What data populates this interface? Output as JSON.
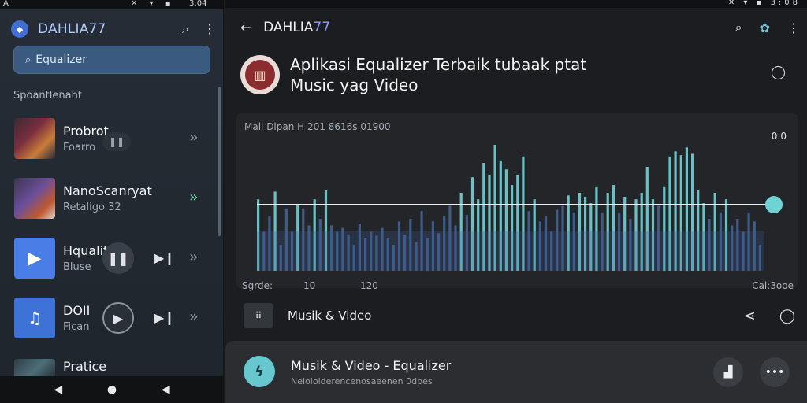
{
  "status_left": {
    "left": "A",
    "icons": "✕ ▾ ▪",
    "time": "3:04"
  },
  "status_right": {
    "icons": "✕ ▾ ▪ 3:08"
  },
  "left_panel": {
    "app_title": "DAHLIA77",
    "search_placeholder": "Equalizer",
    "section_label": "Spoantlenaht",
    "items": [
      {
        "title": "Probrot",
        "subtitle": "Foarro"
      },
      {
        "title": "NanoScanryat",
        "subtitle": "Retaligo 32"
      },
      {
        "title": "Hqualit",
        "subtitle": "Bluse"
      },
      {
        "title": "DOII",
        "subtitle": "Fican"
      },
      {
        "title": "Pratice",
        "subtitle": ""
      }
    ]
  },
  "right_panel": {
    "title_prefix": "DAHLIA",
    "title_accent": "77",
    "headline": "Aplikasi Equalizer Terbaik tubaak ptat Music yag Video",
    "eq_info": "Mall Dlpan H 201 8616s 01900",
    "eq_time": "0:0",
    "axis": {
      "start": "Sgrde:",
      "t1": "10",
      "t2": "120",
      "end": "Cal:3ooe"
    },
    "tag_label": "Musik & Video",
    "tag_icon_text": "⠿",
    "bottom_title": "Musik & Video - Equalizer",
    "bottom_subtitle": "Neloloiderencenosaeenen 0dpes"
  },
  "colors": {
    "accent_teal": "#6ec5d8",
    "bar_teal": "#6fd3d6",
    "bar_blue": "#4a6ea8",
    "title_blue": "#aec9ff"
  },
  "equalizer": {
    "progress": 1.0,
    "bars": [
      0.55,
      0.3,
      0.42,
      0.61,
      0.2,
      0.48,
      0.3,
      0.51,
      0.48,
      0.35,
      0.55,
      0.4,
      0.62,
      0.35,
      0.3,
      0.33,
      0.28,
      0.2,
      0.36,
      0.25,
      0.3,
      0.27,
      0.33,
      0.25,
      0.2,
      0.38,
      0.28,
      0.4,
      0.22,
      0.46,
      0.25,
      0.38,
      0.29,
      0.42,
      0.5,
      0.35,
      0.6,
      0.43,
      0.72,
      0.55,
      0.83,
      0.74,
      0.97,
      0.85,
      0.78,
      0.66,
      0.74,
      0.88,
      0.46,
      0.55,
      0.38,
      0.42,
      0.3,
      0.47,
      0.5,
      0.58,
      0.45,
      0.6,
      0.57,
      0.52,
      0.65,
      0.45,
      0.6,
      0.66,
      0.45,
      0.57,
      0.4,
      0.55,
      0.6,
      0.8,
      0.55,
      0.5,
      0.65,
      0.88,
      0.92,
      0.89,
      0.95,
      0.9,
      0.62,
      0.52,
      0.4,
      0.6,
      0.45,
      0.55,
      0.35,
      0.4,
      0.3,
      0.45,
      0.38,
      0.2
    ]
  }
}
